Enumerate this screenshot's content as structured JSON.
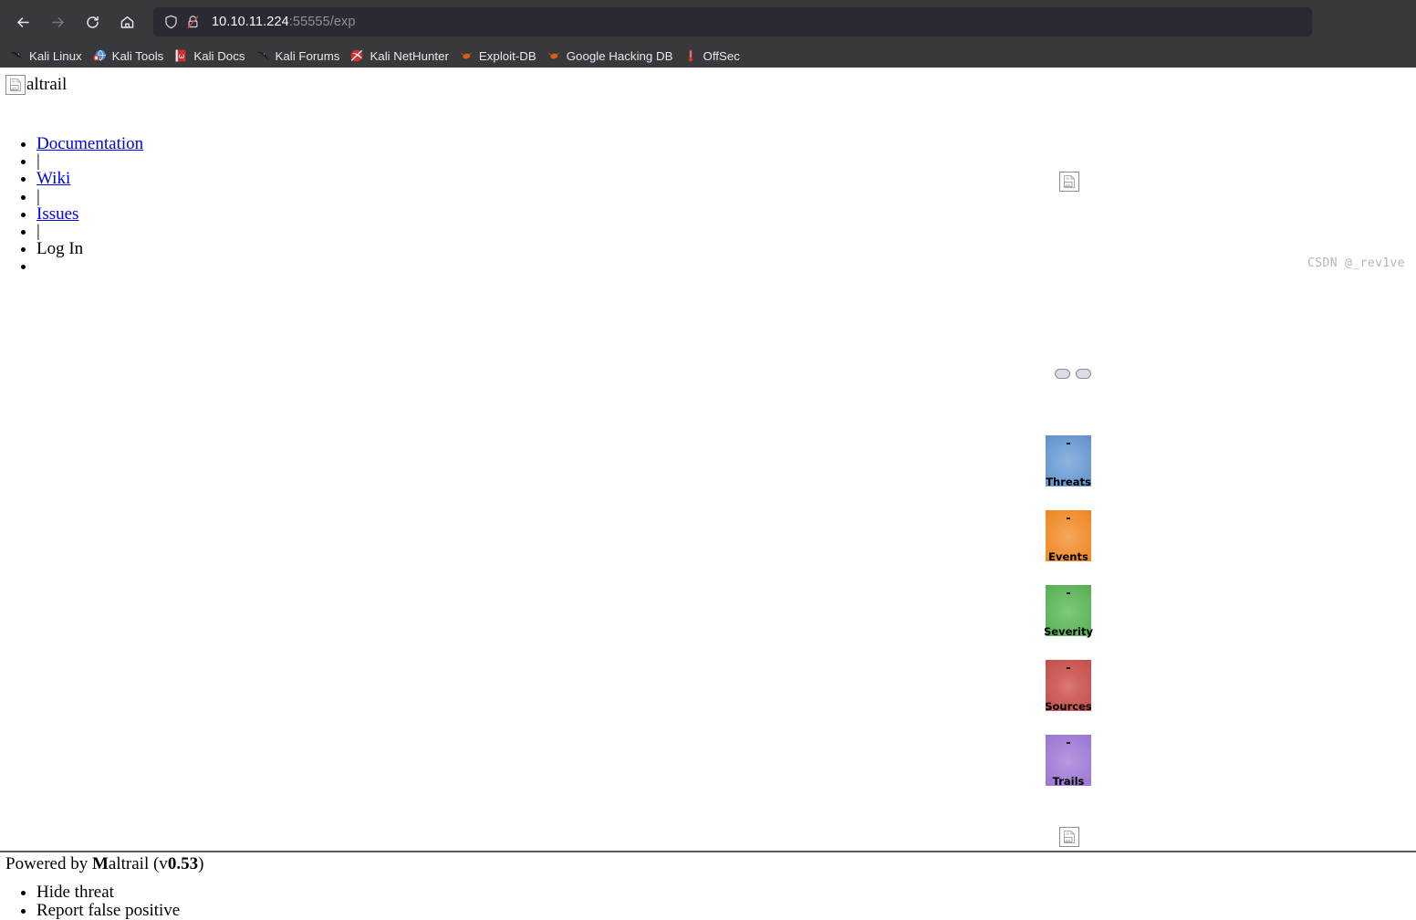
{
  "browser": {
    "nav": [
      {
        "name": "back-button",
        "icon": "arrow-left-icon",
        "enabled": true
      },
      {
        "name": "forward-button",
        "icon": "arrow-right-icon",
        "enabled": false
      },
      {
        "name": "reload-button",
        "icon": "reload-icon",
        "enabled": true
      },
      {
        "name": "home-button",
        "icon": "home-icon",
        "enabled": true
      }
    ],
    "urlbar": {
      "shield_icon": "shield-icon",
      "lock_icon": "lock-crossed-icon",
      "host": "10.10.11.224",
      "path": ":55555/exp",
      "full_url": "10.10.11.224:55555/exp"
    },
    "bookmarks": [
      {
        "label": "Kali Linux",
        "icon": "kali-dragon-icon"
      },
      {
        "label": "Kali Tools",
        "icon": "kali-tools-icon"
      },
      {
        "label": "Kali Docs",
        "icon": "kali-docs-icon"
      },
      {
        "label": "Kali Forums",
        "icon": "kali-forums-icon"
      },
      {
        "label": "Kali NetHunter",
        "icon": "kali-nethunter-icon"
      },
      {
        "label": "Exploit-DB",
        "icon": "exploit-db-icon"
      },
      {
        "label": "Google Hacking DB",
        "icon": "google-hacking-db-icon"
      },
      {
        "label": "OffSec",
        "icon": "offsec-icon"
      }
    ]
  },
  "page": {
    "brand": {
      "logo_icon": "broken-image-icon",
      "text": "altrail"
    },
    "menu": [
      {
        "label": "Documentation",
        "type": "link"
      },
      {
        "label": "|",
        "type": "separator"
      },
      {
        "label": "Wiki",
        "type": "link"
      },
      {
        "label": "|",
        "type": "separator"
      },
      {
        "label": "Issues",
        "type": "link"
      },
      {
        "label": "|",
        "type": "separator"
      },
      {
        "label": "Log In",
        "type": "text"
      },
      {
        "label": "",
        "type": "empty"
      }
    ],
    "right_column": {
      "top_image_icon": "broken-image-icon",
      "pills": [
        {
          "name": "toggle-pill-1"
        },
        {
          "name": "toggle-pill-2"
        }
      ],
      "cards": [
        {
          "label": "Threats",
          "value": "-",
          "color": "#7da8da"
        },
        {
          "label": "Events",
          "value": "-",
          "color": "#f29a45"
        },
        {
          "label": "Severity",
          "value": "-",
          "color": "#6fbf6c"
        },
        {
          "label": "Sources",
          "value": "-",
          "color": "#d06462"
        },
        {
          "label": "Trails",
          "value": "-",
          "color": "#ab8bdb"
        }
      ],
      "bottom_image_icon": "broken-image-icon"
    },
    "footer": {
      "powered_prefix": "Powered by ",
      "powered_bold_m": "M",
      "powered_middle": "altrail (v",
      "powered_version": "0.53",
      "powered_suffix": ")",
      "actions": [
        {
          "label": "Hide threat"
        },
        {
          "label": "Report false positive"
        }
      ]
    }
  },
  "watermark": {
    "text": "CSDN @_rev1ve"
  }
}
